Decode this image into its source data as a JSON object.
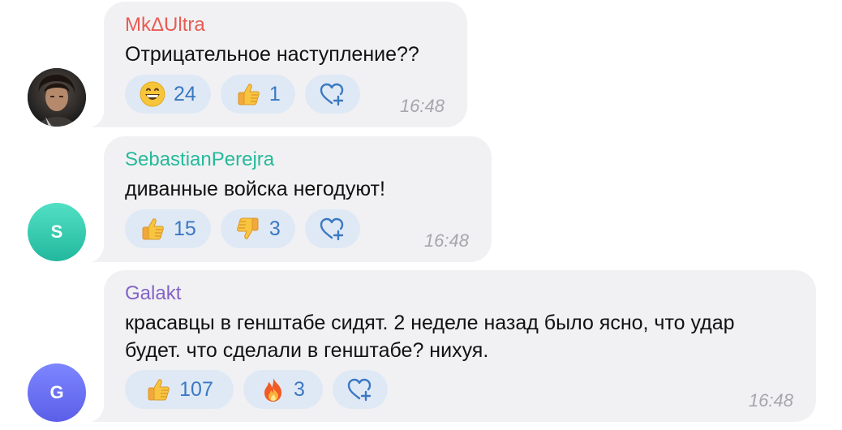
{
  "colors": {
    "bubble": "#f1f1f3",
    "reaction_bg": "#dfe9f5",
    "reaction_count": "#3b78c3",
    "time": "#a6a6ab",
    "author_1": "#e85b53",
    "author_2": "#26b99a",
    "author_3": "#8463c7"
  },
  "comments": [
    {
      "author": "MkΔUltra",
      "text": "Отрицательное наступление??",
      "time": "16:48",
      "avatar": {
        "type": "photo",
        "icon": "user-photo"
      },
      "reactions": [
        {
          "icon": "grinning-face-icon",
          "count": "24"
        },
        {
          "icon": "thumbs-up-icon",
          "count": "1"
        }
      ]
    },
    {
      "author": "SebastianPerejra",
      "text": "диванные войска негодуют!",
      "time": "16:48",
      "avatar": {
        "type": "letter",
        "letter": "S"
      },
      "reactions": [
        {
          "icon": "thumbs-up-icon",
          "count": "15"
        },
        {
          "icon": "thumbs-down-icon",
          "count": "3"
        }
      ]
    },
    {
      "author": "Galakt",
      "text_line1": "красавцы в генштабе сидят. 2 неделе назад было ясно, что удар",
      "text_line2": "будет.  что сделали в генштабе? нихуя.",
      "time": "16:48",
      "avatar": {
        "type": "letter",
        "letter": "G"
      },
      "reactions": [
        {
          "icon": "thumbs-up-icon",
          "count": "107"
        },
        {
          "icon": "fire-icon",
          "count": "3"
        }
      ]
    }
  ]
}
